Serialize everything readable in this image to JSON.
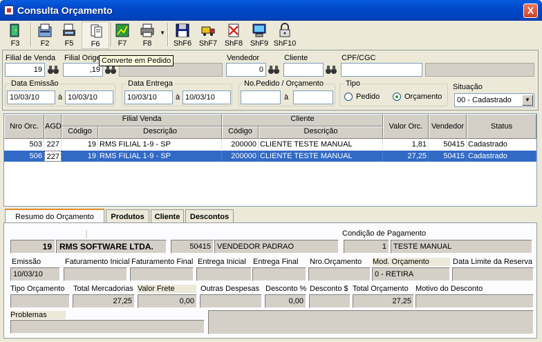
{
  "window": {
    "title": "Consulta Orçamento",
    "close": "X"
  },
  "toolbar": [
    {
      "name": "f3-button",
      "label": "F3",
      "icon": "exit-door-icon"
    },
    {
      "name": "f2-button",
      "label": "F2",
      "icon": "document-clipboard-icon"
    },
    {
      "name": "f5-button",
      "label": "F5",
      "icon": "print-preview-icon"
    },
    {
      "name": "f6-button",
      "label": "F6",
      "icon": "convert-document-icon"
    },
    {
      "name": "f7-button",
      "label": "F7",
      "icon": "spreadsheet-icon"
    },
    {
      "name": "f8-button",
      "label": "F8",
      "icon": "printer-icon"
    },
    {
      "name": "shf6-button",
      "label": "ShF6",
      "icon": "floppy-disk-icon"
    },
    {
      "name": "shf7-button",
      "label": "ShF7",
      "icon": "truck-icon"
    },
    {
      "name": "shf8-button",
      "label": "ShF8",
      "icon": "cancel-document-icon"
    },
    {
      "name": "shf9-button",
      "label": "ShF9",
      "icon": "computer-icon"
    },
    {
      "name": "shf10-button",
      "label": "ShF10",
      "icon": "lock-icon"
    }
  ],
  "tooltip": "Converte em Pedido",
  "filters": {
    "filial_venda_label": "Filial de Venda",
    "filial_venda_value": "19",
    "filial_origem_label": "Filial Origem",
    "filial_origem_value": ",19",
    "vendedor_label": "Vendedor",
    "vendedor_value": "0",
    "cliente_label": "Cliente",
    "cpf_label": "CPF/CGC",
    "data_emissao_label": "Data Emissão",
    "data_emissao_de": "10/03/10",
    "data_emissao_ate": "10/03/10",
    "a_label": "à",
    "data_entrega_label": "Data Entrega",
    "data_entrega_de": "10/03/10",
    "data_entrega_ate": "10/03/10",
    "nro_pedido_label": "No.Pedido / Orçamento",
    "tipo_label": "Tipo",
    "tipo_pedido": "Pedido",
    "tipo_orcamento": "Orçamento",
    "situacao_label": "Situação",
    "situacao_value": "00 - Cadastrado"
  },
  "grid": {
    "headers": {
      "nro": "Nro Orc.",
      "agd": "AGD",
      "filial_venda": "Filial Venda",
      "codigo": "Código",
      "descricao": "Descrição",
      "cliente": "Cliente",
      "valor": "Valor Orc.",
      "vendedor": "Vendedor",
      "status": "Status"
    },
    "rows": [
      {
        "nro": "503",
        "agd": "227",
        "fcod": "19",
        "fdesc": "RMS FILIAL 1-9 - SP",
        "ccod": "200000",
        "cdesc": "CLIENTE TESTE MANUAL",
        "valor": "1,81",
        "vend": "50415",
        "status": "Cadastrado"
      },
      {
        "nro": "506",
        "agd": "227",
        "fcod": "19",
        "fdesc": "RMS FILIAL 1-9 - SP",
        "ccod": "200000",
        "cdesc": "CLIENTE TESTE MANUAL",
        "valor": "27,25",
        "vend": "50415",
        "status": "Cadastrado"
      }
    ]
  },
  "tabs": [
    "Resumo do Orçamento",
    "Produtos",
    "Cliente",
    "Descontos"
  ],
  "resumo": {
    "filial_cod": "19",
    "filial_nome": "RMS SOFTWARE LTDA.",
    "vend_cod": "50415",
    "vend_nome": "VENDEDOR PADRAO",
    "cond_label": "Condição de Pagamento",
    "cond_cod": "1",
    "cond_nome": "TESTE MANUAL",
    "emissao_label": "Emissão",
    "emissao_value": "10/03/10",
    "fat_ini_label": "Faturamento Inicial",
    "fat_fim_label": "Faturamento Final",
    "ent_ini_label": "Entrega Inicial",
    "ent_fim_label": "Entrega Final",
    "nro_orc_label": "Nro.Orçamento",
    "mod_label": "Mod. Orçamento",
    "mod_value": "0 - RETIRA",
    "limite_label": "Data Limite da Reserva",
    "tipo_label": "Tipo Orçamento",
    "total_merc_label": "Total Mercadorias",
    "total_merc_value": "27,25",
    "frete_label": "Valor Frete",
    "frete_value": "0,00",
    "outras_label": "Outras Despesas",
    "desc_pct_label": "Desconto %",
    "desc_pct_value": "0,00",
    "desc_val_label": "Desconto $",
    "total_orc_label": "Total Orçamento",
    "total_orc_value": "27,25",
    "motivo_label": "Motivo do Desconto",
    "problemas_label": "Problemas"
  }
}
